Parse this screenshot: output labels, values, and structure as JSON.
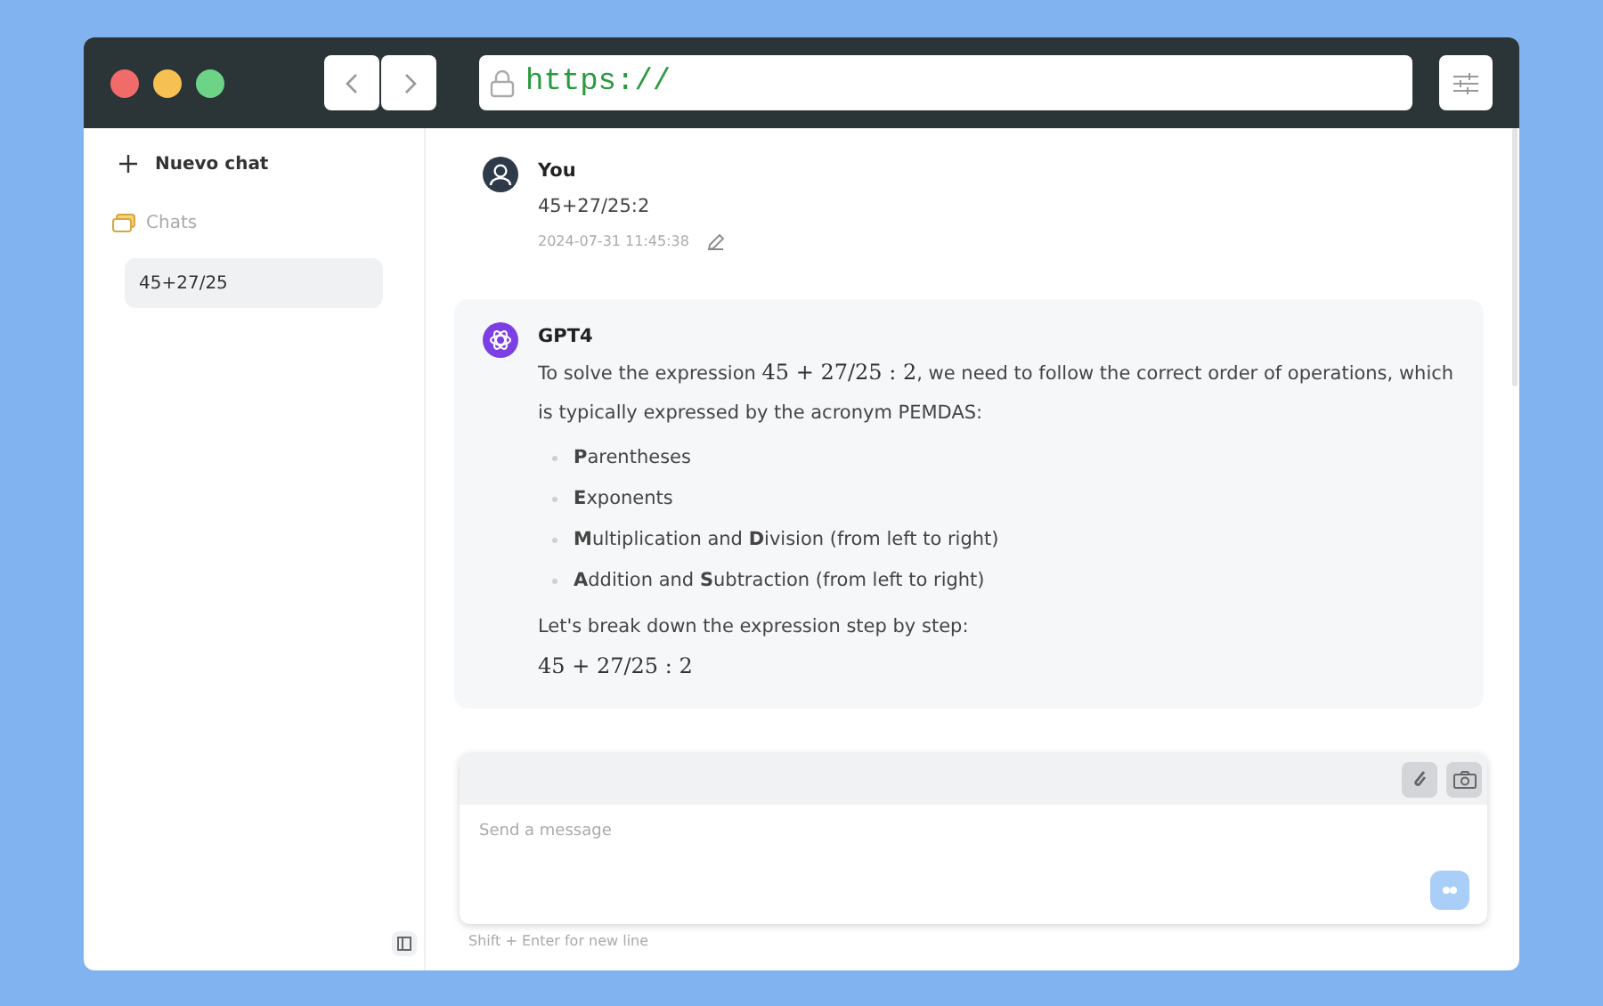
{
  "browser": {
    "url": "https://"
  },
  "sidebar": {
    "new_chat": "Nuevo chat",
    "section": "Chats",
    "chats": [
      {
        "label": "45+27/25",
        "selected": true
      }
    ]
  },
  "messages": [
    {
      "kind": "user",
      "author": "You",
      "content": [
        {
          "kind": "paragraph",
          "parts": [
            {
              "kind": "text",
              "text": "45+27/25:2"
            }
          ]
        }
      ],
      "time": "2024-07-31 11:45:38"
    },
    {
      "kind": "assistant",
      "author": "GPT4",
      "content": [
        {
          "kind": "paragraph",
          "parts": [
            {
              "kind": "text",
              "text": "To solve the expression "
            },
            {
              "kind": "math",
              "text": "45 + 27/25 : 2"
            },
            {
              "kind": "text",
              "text": ", we need to follow the correct order of operations, which is typically expressed by the acronym PEMDAS:"
            }
          ]
        },
        {
          "kind": "list",
          "items": [
            "**P**arentheses",
            "**E**xponents",
            "**M**ultiplication and **D**ivision (from left to right)",
            "**A**ddition and **S**ubtraction (from left to right)"
          ]
        },
        {
          "kind": "paragraph",
          "parts": [
            {
              "kind": "text",
              "text": "Let's break down the expression step by step:"
            }
          ]
        },
        {
          "kind": "paragraph",
          "parts": [
            {
              "kind": "math",
              "text": "45 + 27/25 : 2"
            }
          ]
        }
      ]
    }
  ],
  "composer": {
    "placeholder": "Send a message",
    "hint": "Shift + Enter for new line"
  }
}
